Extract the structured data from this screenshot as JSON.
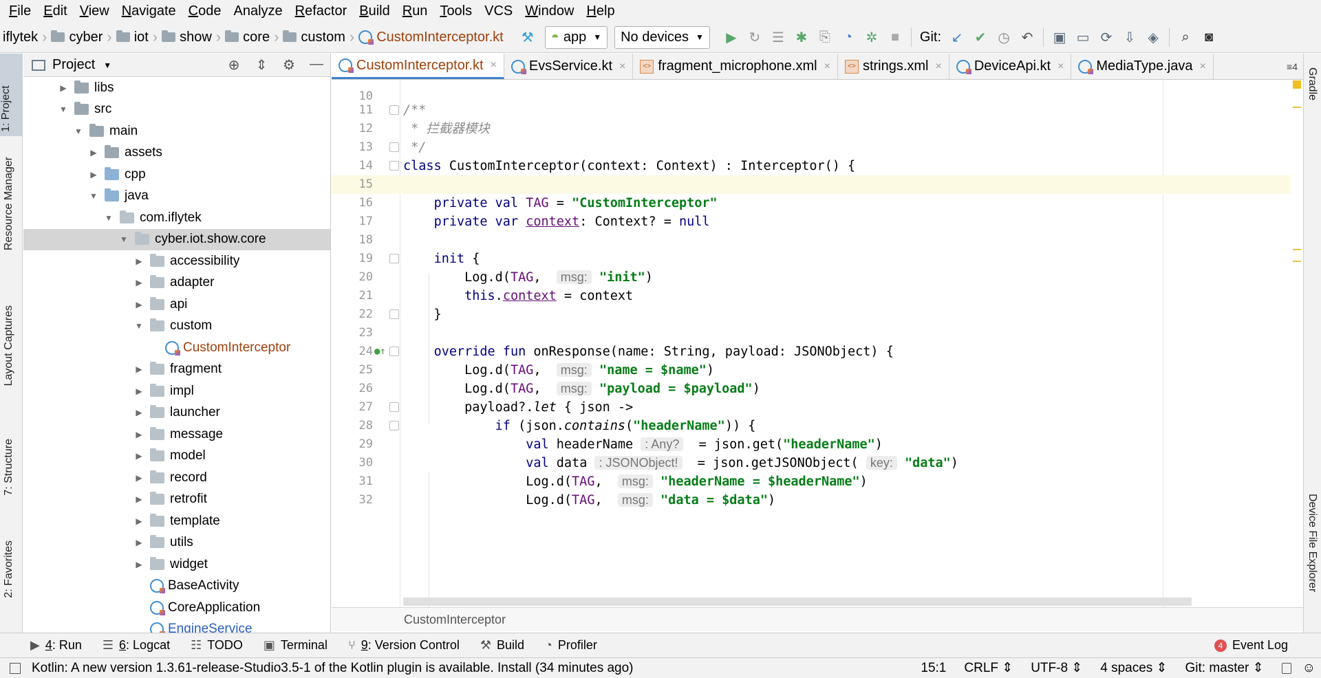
{
  "menu": [
    {
      "mnemonic": "F",
      "rest": "ile"
    },
    {
      "mnemonic": "E",
      "rest": "dit"
    },
    {
      "mnemonic": "V",
      "rest": "iew"
    },
    {
      "mnemonic": "N",
      "rest": "avigate"
    },
    {
      "mnemonic": "C",
      "rest": "ode"
    },
    {
      "mnemonic": "",
      "rest": "Analyze"
    },
    {
      "mnemonic": "R",
      "rest": "efactor"
    },
    {
      "mnemonic": "B",
      "rest": "uild"
    },
    {
      "mnemonic": "R",
      "rest": "un"
    },
    {
      "mnemonic": "T",
      "rest": "ools"
    },
    {
      "mnemonic": "",
      "rest": "VCS"
    },
    {
      "mnemonic": "W",
      "rest": "indow"
    },
    {
      "mnemonic": "H",
      "rest": "elp"
    }
  ],
  "breadcrumbs": [
    "iflytek",
    "cyber",
    "iot",
    "show",
    "core",
    "custom"
  ],
  "breadcrumb_file": "CustomInterceptor.kt",
  "toolbar": {
    "run_config": "app",
    "device": "No devices",
    "git_label": "Git:"
  },
  "left_tabs": {
    "project": "1: Project",
    "resource": "Resource Manager",
    "layout": "Layout Captures",
    "structure": "7: Structure",
    "favorites": "2: Favorites"
  },
  "right_tabs": {
    "gradle": "Gradle",
    "device_explorer": "Device File Explorer"
  },
  "project_panel": {
    "title": "Project"
  },
  "tree": [
    {
      "label": "libs",
      "indent": 0,
      "arrow": "▶",
      "icon": "dir"
    },
    {
      "label": "src",
      "indent": 0,
      "arrow": "▼",
      "icon": "dir"
    },
    {
      "label": "main",
      "indent": 1,
      "arrow": "▼",
      "icon": "dir"
    },
    {
      "label": "assets",
      "indent": 2,
      "arrow": "▶",
      "icon": "dir"
    },
    {
      "label": "cpp",
      "indent": 2,
      "arrow": "▶",
      "icon": "src"
    },
    {
      "label": "java",
      "indent": 2,
      "arrow": "▼",
      "icon": "src"
    },
    {
      "label": "com.iflytek",
      "indent": 3,
      "arrow": "▼",
      "icon": "pkg"
    },
    {
      "label": "cyber.iot.show.core",
      "indent": 4,
      "arrow": "▼",
      "icon": "pkg",
      "selected": true
    },
    {
      "label": "accessibility",
      "indent": 5,
      "arrow": "▶",
      "icon": "pkg"
    },
    {
      "label": "adapter",
      "indent": 5,
      "arrow": "▶",
      "icon": "pkg"
    },
    {
      "label": "api",
      "indent": 5,
      "arrow": "▶",
      "icon": "pkg"
    },
    {
      "label": "custom",
      "indent": 5,
      "arrow": "▼",
      "icon": "pkg"
    },
    {
      "label": "CustomInterceptor",
      "indent": 6,
      "arrow": "",
      "icon": "kt",
      "highlight": true
    },
    {
      "label": "fragment",
      "indent": 5,
      "arrow": "▶",
      "icon": "pkg"
    },
    {
      "label": "impl",
      "indent": 5,
      "arrow": "▶",
      "icon": "pkg"
    },
    {
      "label": "launcher",
      "indent": 5,
      "arrow": "▶",
      "icon": "pkg"
    },
    {
      "label": "message",
      "indent": 5,
      "arrow": "▶",
      "icon": "pkg"
    },
    {
      "label": "model",
      "indent": 5,
      "arrow": "▶",
      "icon": "pkg"
    },
    {
      "label": "record",
      "indent": 5,
      "arrow": "▶",
      "icon": "pkg"
    },
    {
      "label": "retrofit",
      "indent": 5,
      "arrow": "▶",
      "icon": "pkg"
    },
    {
      "label": "template",
      "indent": 5,
      "arrow": "▶",
      "icon": "pkg"
    },
    {
      "label": "utils",
      "indent": 5,
      "arrow": "▶",
      "icon": "pkg"
    },
    {
      "label": "widget",
      "indent": 5,
      "arrow": "▶",
      "icon": "pkg"
    },
    {
      "label": "BaseActivity",
      "indent": 5,
      "arrow": "",
      "icon": "kt"
    },
    {
      "label": "CoreApplication",
      "indent": 5,
      "arrow": "",
      "icon": "kt"
    },
    {
      "label": "EngineService",
      "indent": 5,
      "arrow": "",
      "icon": "kt",
      "highlight_blue": true
    }
  ],
  "tabs": [
    {
      "label": "CustomInterceptor.kt",
      "icon": "kt",
      "active": true
    },
    {
      "label": "EvsService.kt",
      "icon": "kt"
    },
    {
      "label": "fragment_microphone.xml",
      "icon": "xml"
    },
    {
      "label": "strings.xml",
      "icon": "xml"
    },
    {
      "label": "DeviceApi.kt",
      "icon": "kt"
    },
    {
      "label": "MediaType.java",
      "icon": "java"
    }
  ],
  "tabs_more": "4",
  "code_lines": [
    {
      "n": "10",
      "html": ""
    },
    {
      "n": "11",
      "html": "<span class='c'>/**</span>",
      "fold": true
    },
    {
      "n": "12",
      "html": "<span class='c'> * 拦截器模块</span>"
    },
    {
      "n": "13",
      "html": "<span class='c'> */</span>",
      "fold": true
    },
    {
      "n": "14",
      "html": "<span class='k'>class</span> CustomInterceptor(context: Context) : Interceptor() {",
      "fold": true
    },
    {
      "n": "15",
      "html": "",
      "current": true
    },
    {
      "n": "16",
      "html": "    <span class='k'>private val</span> <span class='p'>TAG</span> = <span class='s'>\"CustomInterceptor\"</span>"
    },
    {
      "n": "17",
      "html": "    <span class='k'>private var</span> <span class='u'>context</span>: Context? = <span class='k'>null</span>"
    },
    {
      "n": "18",
      "html": ""
    },
    {
      "n": "19",
      "html": "    <span class='k'>init</span> {",
      "fold": true
    },
    {
      "n": "20",
      "html": "        Log.d(<span class='p'>TAG</span>,  <span class='hint'>msg:</span> <span class='s'>\"init\"</span>)"
    },
    {
      "n": "21",
      "html": "        <span class='k'>this</span>.<span class='u'>context</span> = context"
    },
    {
      "n": "22",
      "html": "    }",
      "fold": true
    },
    {
      "n": "23",
      "html": ""
    },
    {
      "n": "24",
      "html": "    <span class='k'>override fun</span> onResponse(name: String, payload: JSONObject) {",
      "fold": true,
      "override": true
    },
    {
      "n": "25",
      "html": "        Log.d(<span class='p'>TAG</span>,  <span class='hint'>msg:</span> <span class='s'>\"name = $name\"</span>)"
    },
    {
      "n": "26",
      "html": "        Log.d(<span class='p'>TAG</span>,  <span class='hint'>msg:</span> <span class='s'>\"payload = $payload\"</span>)"
    },
    {
      "n": "27",
      "html": "        payload?.<span class='it'>let</span> { json -&gt;",
      "fold": true
    },
    {
      "n": "28",
      "html": "            <span class='k'>if</span> (json.<span class='it'>contains</span>(<span class='s'>\"headerName\"</span>)) {",
      "fold": true
    },
    {
      "n": "29",
      "html": "                <span class='k'>val</span> headerName <span class='hint'>: Any?</span>  = json.get(<span class='s'>\"headerName\"</span>)"
    },
    {
      "n": "30",
      "html": "                <span class='k'>val</span> data <span class='hint'>: JSONObject!</span>  = json.getJSONObject( <span class='hint'>key:</span> <span class='s'>\"data\"</span>)"
    },
    {
      "n": "31",
      "html": "                Log.d(<span class='p'>TAG</span>,  <span class='hint'>msg:</span> <span class='s'>\"headerName = $headerName\"</span>)"
    },
    {
      "n": "32",
      "html": "                Log.d(<span class='p'>TAG</span>,  <span class='hint'>msg:</span> <span class='s'>\"data = $data\"</span>)"
    }
  ],
  "editor_breadcrumb": "CustomInterceptor",
  "tool_windows": {
    "run": {
      "m": "4",
      "rest": ": Run"
    },
    "logcat": {
      "m": "6",
      "rest": ": Logcat"
    },
    "todo": "TODO",
    "terminal": "Terminal",
    "vcs": {
      "m": "9",
      "rest": ": Version Control"
    },
    "build": "Build",
    "profiler": "Profiler",
    "event_log": "Event Log",
    "event_count": "4"
  },
  "status": {
    "message": "Kotlin: A new version 1.3.61-release-Studio3.5-1 of the Kotlin plugin is available. Install (34 minutes ago)",
    "position": "15:1",
    "line_sep": "CRLF ⇕",
    "encoding": "UTF-8 ⇕",
    "indent": "4 spaces ⇕",
    "git": "Git: master ⇕"
  }
}
